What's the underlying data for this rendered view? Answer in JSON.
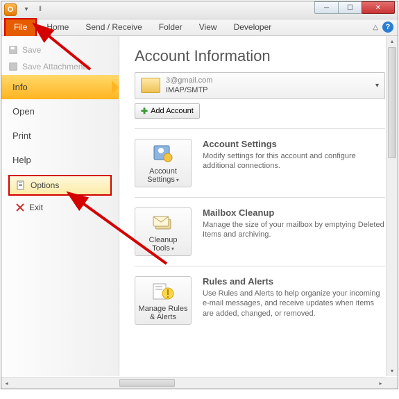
{
  "titlebar": {
    "app_letter": "O"
  },
  "win": {
    "min": "─",
    "max": "☐",
    "close": "✕"
  },
  "tabs": {
    "file": "File",
    "home": "Home",
    "sendreceive": "Send / Receive",
    "folder": "Folder",
    "view": "View",
    "developer": "Developer"
  },
  "side": {
    "save": "Save",
    "save_attachments": "Save Attachments",
    "info": "Info",
    "open": "Open",
    "print": "Print",
    "help": "Help",
    "options": "Options",
    "exit": "Exit"
  },
  "main": {
    "heading": "Account Information",
    "account_email": "3@gmail.com",
    "account_proto": "IMAP/SMTP",
    "add_account": "Add Account",
    "tiles": [
      {
        "button": "Account Settings",
        "title": "Account Settings",
        "desc": "Modify settings for this account and configure additional connections."
      },
      {
        "button": "Cleanup Tools",
        "title": "Mailbox Cleanup",
        "desc": "Manage the size of your mailbox by emptying Deleted Items and archiving."
      },
      {
        "button": "Manage Rules & Alerts",
        "title": "Rules and Alerts",
        "desc": "Use Rules and Alerts to help organize your incoming e-mail messages, and receive updates when items are added, changed, or removed."
      }
    ]
  },
  "colors": {
    "accent": "#e65c00",
    "highlight": "#d40000"
  }
}
